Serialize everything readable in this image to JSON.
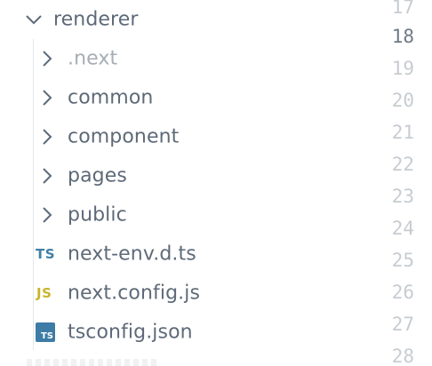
{
  "explorer": {
    "root_folder": "renderer",
    "items": [
      {
        "label": ".next",
        "kind": "folder",
        "dimmed": true
      },
      {
        "label": "common",
        "kind": "folder"
      },
      {
        "label": "component",
        "kind": "folder"
      },
      {
        "label": "pages",
        "kind": "folder"
      },
      {
        "label": "public",
        "kind": "folder"
      },
      {
        "label": "next-env.d.ts",
        "kind": "file",
        "icon": "TS"
      },
      {
        "label": "next.config.js",
        "kind": "file",
        "icon": "JS"
      },
      {
        "label": "tsconfig.json",
        "kind": "file",
        "icon": "TS"
      }
    ]
  },
  "gutter": {
    "line_numbers": [
      "17",
      "18",
      "19",
      "20",
      "21",
      "22",
      "23",
      "24",
      "25",
      "26",
      "27",
      "28"
    ],
    "active_line": "18"
  },
  "colors": {
    "text": "#5e6a78",
    "dim_text": "#a6adb5",
    "ts_icon": "#3f7fa6",
    "js_icon": "#c9b52d",
    "line_number": "#c7ccd1",
    "active_line_number": "#6f7a85"
  }
}
